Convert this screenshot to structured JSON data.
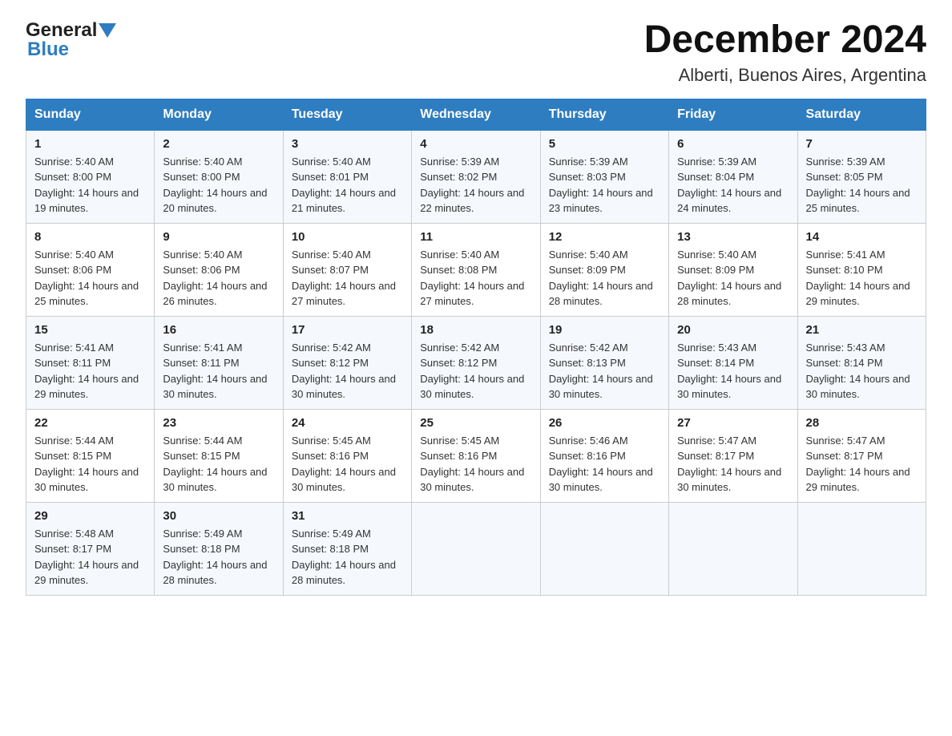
{
  "header": {
    "logo_general": "General",
    "logo_blue": "Blue",
    "month_title": "December 2024",
    "location": "Alberti, Buenos Aires, Argentina"
  },
  "days_of_week": [
    "Sunday",
    "Monday",
    "Tuesday",
    "Wednesday",
    "Thursday",
    "Friday",
    "Saturday"
  ],
  "weeks": [
    [
      {
        "day": "1",
        "sunrise": "5:40 AM",
        "sunset": "8:00 PM",
        "daylight": "14 hours and 19 minutes."
      },
      {
        "day": "2",
        "sunrise": "5:40 AM",
        "sunset": "8:00 PM",
        "daylight": "14 hours and 20 minutes."
      },
      {
        "day": "3",
        "sunrise": "5:40 AM",
        "sunset": "8:01 PM",
        "daylight": "14 hours and 21 minutes."
      },
      {
        "day": "4",
        "sunrise": "5:39 AM",
        "sunset": "8:02 PM",
        "daylight": "14 hours and 22 minutes."
      },
      {
        "day": "5",
        "sunrise": "5:39 AM",
        "sunset": "8:03 PM",
        "daylight": "14 hours and 23 minutes."
      },
      {
        "day": "6",
        "sunrise": "5:39 AM",
        "sunset": "8:04 PM",
        "daylight": "14 hours and 24 minutes."
      },
      {
        "day": "7",
        "sunrise": "5:39 AM",
        "sunset": "8:05 PM",
        "daylight": "14 hours and 25 minutes."
      }
    ],
    [
      {
        "day": "8",
        "sunrise": "5:40 AM",
        "sunset": "8:06 PM",
        "daylight": "14 hours and 25 minutes."
      },
      {
        "day": "9",
        "sunrise": "5:40 AM",
        "sunset": "8:06 PM",
        "daylight": "14 hours and 26 minutes."
      },
      {
        "day": "10",
        "sunrise": "5:40 AM",
        "sunset": "8:07 PM",
        "daylight": "14 hours and 27 minutes."
      },
      {
        "day": "11",
        "sunrise": "5:40 AM",
        "sunset": "8:08 PM",
        "daylight": "14 hours and 27 minutes."
      },
      {
        "day": "12",
        "sunrise": "5:40 AM",
        "sunset": "8:09 PM",
        "daylight": "14 hours and 28 minutes."
      },
      {
        "day": "13",
        "sunrise": "5:40 AM",
        "sunset": "8:09 PM",
        "daylight": "14 hours and 28 minutes."
      },
      {
        "day": "14",
        "sunrise": "5:41 AM",
        "sunset": "8:10 PM",
        "daylight": "14 hours and 29 minutes."
      }
    ],
    [
      {
        "day": "15",
        "sunrise": "5:41 AM",
        "sunset": "8:11 PM",
        "daylight": "14 hours and 29 minutes."
      },
      {
        "day": "16",
        "sunrise": "5:41 AM",
        "sunset": "8:11 PM",
        "daylight": "14 hours and 30 minutes."
      },
      {
        "day": "17",
        "sunrise": "5:42 AM",
        "sunset": "8:12 PM",
        "daylight": "14 hours and 30 minutes."
      },
      {
        "day": "18",
        "sunrise": "5:42 AM",
        "sunset": "8:12 PM",
        "daylight": "14 hours and 30 minutes."
      },
      {
        "day": "19",
        "sunrise": "5:42 AM",
        "sunset": "8:13 PM",
        "daylight": "14 hours and 30 minutes."
      },
      {
        "day": "20",
        "sunrise": "5:43 AM",
        "sunset": "8:14 PM",
        "daylight": "14 hours and 30 minutes."
      },
      {
        "day": "21",
        "sunrise": "5:43 AM",
        "sunset": "8:14 PM",
        "daylight": "14 hours and 30 minutes."
      }
    ],
    [
      {
        "day": "22",
        "sunrise": "5:44 AM",
        "sunset": "8:15 PM",
        "daylight": "14 hours and 30 minutes."
      },
      {
        "day": "23",
        "sunrise": "5:44 AM",
        "sunset": "8:15 PM",
        "daylight": "14 hours and 30 minutes."
      },
      {
        "day": "24",
        "sunrise": "5:45 AM",
        "sunset": "8:16 PM",
        "daylight": "14 hours and 30 minutes."
      },
      {
        "day": "25",
        "sunrise": "5:45 AM",
        "sunset": "8:16 PM",
        "daylight": "14 hours and 30 minutes."
      },
      {
        "day": "26",
        "sunrise": "5:46 AM",
        "sunset": "8:16 PM",
        "daylight": "14 hours and 30 minutes."
      },
      {
        "day": "27",
        "sunrise": "5:47 AM",
        "sunset": "8:17 PM",
        "daylight": "14 hours and 30 minutes."
      },
      {
        "day": "28",
        "sunrise": "5:47 AM",
        "sunset": "8:17 PM",
        "daylight": "14 hours and 29 minutes."
      }
    ],
    [
      {
        "day": "29",
        "sunrise": "5:48 AM",
        "sunset": "8:17 PM",
        "daylight": "14 hours and 29 minutes."
      },
      {
        "day": "30",
        "sunrise": "5:49 AM",
        "sunset": "8:18 PM",
        "daylight": "14 hours and 28 minutes."
      },
      {
        "day": "31",
        "sunrise": "5:49 AM",
        "sunset": "8:18 PM",
        "daylight": "14 hours and 28 minutes."
      },
      null,
      null,
      null,
      null
    ]
  ]
}
